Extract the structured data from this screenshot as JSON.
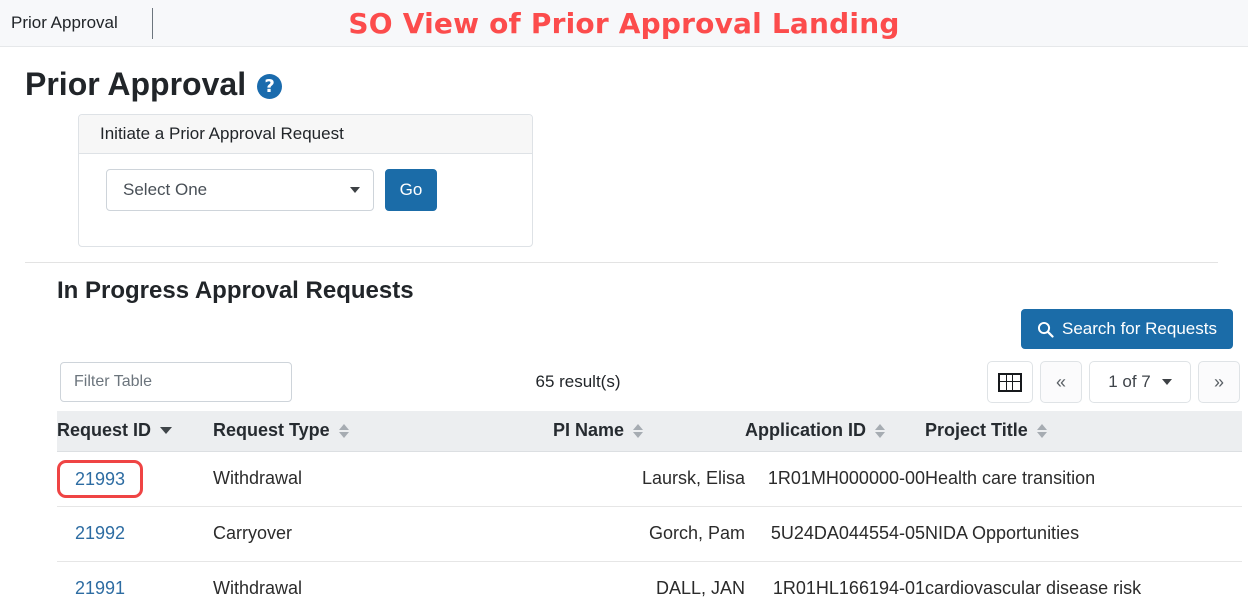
{
  "topbar": {
    "tab_label": "Prior Approval",
    "annotation": "SO View of Prior Approval Landing",
    "annotation_color": "#fc4c4c"
  },
  "page": {
    "title": "Prior Approval",
    "help_icon": "question-circle-icon",
    "accent_color": "#1b6ca8"
  },
  "initiate_card": {
    "header": "Initiate a Prior Approval Request",
    "select_value": "Select One",
    "go_label": "Go"
  },
  "in_progress": {
    "section_title": "In Progress Approval Requests",
    "search_button_label": "Search for Requests",
    "search_icon": "search-icon",
    "filter_placeholder": "Filter Table",
    "result_count": "65 result(s)",
    "grid_icon": "table-grid-icon",
    "prev_label": "«",
    "next_label": "»",
    "page_indicator": "1 of 7"
  },
  "table": {
    "columns": [
      {
        "label": "Request ID",
        "sort": "desc"
      },
      {
        "label": "Request Type",
        "sort": "both"
      },
      {
        "label": "PI Name",
        "sort": "both"
      },
      {
        "label": "Application ID",
        "sort": "both"
      },
      {
        "label": "Project Title",
        "sort": "both"
      }
    ],
    "rows": [
      {
        "request_id": "21993",
        "request_type": "Withdrawal",
        "pi_name": "Laursk, Elisa",
        "application_id": "1R01MH000000-00",
        "project_title": "Health care transition",
        "highlighted": true
      },
      {
        "request_id": "21992",
        "request_type": "Carryover",
        "pi_name": "Gorch, Pam",
        "application_id": "5U24DA044554-05",
        "project_title": "NIDA Opportunities",
        "highlighted": false
      },
      {
        "request_id": "21991",
        "request_type": "Withdrawal",
        "pi_name": "DALL, JAN",
        "application_id": "1R01HL166194-01",
        "project_title": "cardiovascular disease risk",
        "highlighted": false
      }
    ]
  }
}
